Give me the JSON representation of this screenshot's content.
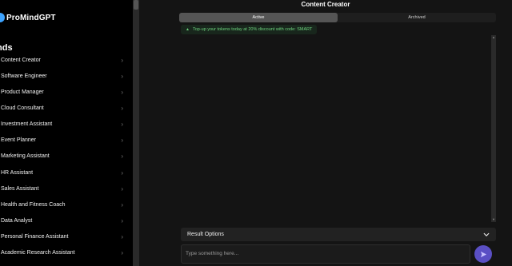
{
  "app": {
    "name": "ProMindGPT"
  },
  "sidebar": {
    "section_title": "nds",
    "items": [
      {
        "label": "Content Creator"
      },
      {
        "label": "Software Engineer"
      },
      {
        "label": "Product Manager"
      },
      {
        "label": "Cloud Consultant"
      },
      {
        "label": "Investment Assistant"
      },
      {
        "label": "Event Planner"
      },
      {
        "label": "Marketing Assistant"
      },
      {
        "label": "HR Assistant"
      },
      {
        "label": "Sales Assistant"
      },
      {
        "label": "Health and Fitness Coach"
      },
      {
        "label": "Data Analyst"
      },
      {
        "label": "Personal Finance Assistant"
      },
      {
        "label": "Academic Research Assistant"
      }
    ]
  },
  "main": {
    "title": "Content Creator",
    "tabs": [
      {
        "label": "Active",
        "active": true
      },
      {
        "label": "Archived",
        "active": false
      }
    ],
    "promo": {
      "icon": "triangle-icon",
      "text": "Top-up your tokens today at 20% discount with code: SMART"
    },
    "result_options": {
      "label": "Result Options"
    },
    "composer": {
      "placeholder": "Type something here..."
    }
  },
  "colors": {
    "sidebar_bg": "#000000",
    "main_bg": "#141414",
    "promo_text": "#6ed37e",
    "send_button": "#5a4fc4",
    "logo_accent": "#3da3ff"
  }
}
